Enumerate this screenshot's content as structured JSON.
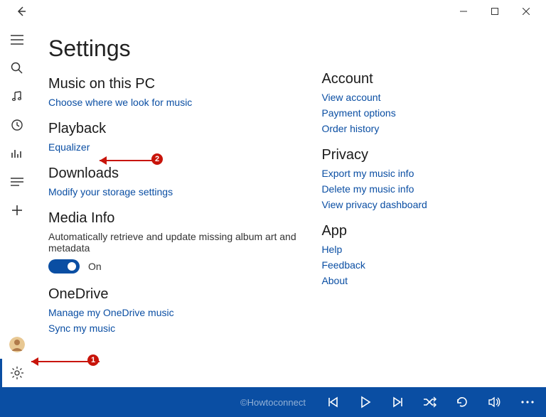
{
  "window": {
    "min": "—",
    "max": "▢",
    "close": "✕"
  },
  "page_title": "Settings",
  "left_sections": {
    "music_pc": {
      "heading": "Music on this PC",
      "choose_link": "Choose where we look for music"
    },
    "playback": {
      "heading": "Playback",
      "equalizer_link": "Equalizer"
    },
    "downloads": {
      "heading": "Downloads",
      "modify_link": "Modify your storage settings"
    },
    "media_info": {
      "heading": "Media Info",
      "desc": "Automatically retrieve and update missing album art and metadata",
      "toggle_label": "On"
    },
    "onedrive": {
      "heading": "OneDrive",
      "manage_link": "Manage my OneDrive music",
      "sync_link": "Sync my music"
    }
  },
  "right_sections": {
    "account": {
      "heading": "Account",
      "view_account": "View account",
      "payment_options": "Payment options",
      "order_history": "Order history"
    },
    "privacy": {
      "heading": "Privacy",
      "export_info": "Export my music info",
      "delete_info": "Delete my music info",
      "view_dashboard": "View privacy dashboard"
    },
    "app": {
      "heading": "App",
      "help": "Help",
      "feedback": "Feedback",
      "about": "About"
    }
  },
  "annotations": {
    "badge1": "1",
    "badge2": "2"
  },
  "watermark": "©Howtoconnect"
}
